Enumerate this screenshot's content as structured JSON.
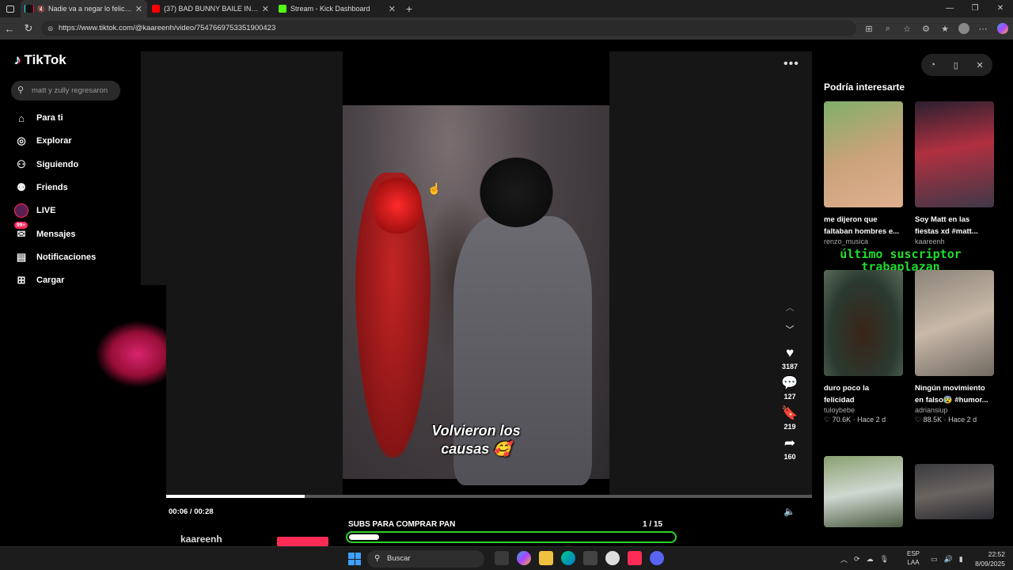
{
  "browser": {
    "tabs": [
      {
        "title": "Nadie va a negar lo felices q",
        "favicon": "tiktok-icon",
        "muted": true,
        "active": true
      },
      {
        "title": "(37) BAD BUNNY BAILE INoLVIDA",
        "favicon": "youtube-icon",
        "active": false
      },
      {
        "title": "Stream - Kick Dashboard",
        "favicon": "kick-icon",
        "active": false
      }
    ],
    "url": "https://www.tiktok.com/@kaareenh/video/7547669753351900423"
  },
  "sidebar": {
    "logo": "TikTok",
    "search_placeholder": "matt y zully regresaron",
    "items": [
      {
        "label": "Para ti",
        "icon": "home-icon"
      },
      {
        "label": "Explorar",
        "icon": "compass-icon"
      },
      {
        "label": "Siguiendo",
        "icon": "following-icon"
      },
      {
        "label": "Friends",
        "icon": "friends-icon"
      },
      {
        "label": "LIVE",
        "icon": "live-avatar"
      },
      {
        "label": "Mensajes",
        "icon": "messages-icon",
        "badge": "99+"
      },
      {
        "label": "Notificaciones",
        "icon": "inbox-icon"
      },
      {
        "label": "Cargar",
        "icon": "upload-icon"
      }
    ]
  },
  "video": {
    "caption_line1": "Volvieron los",
    "caption_line2": "causas 🥰",
    "likes": "3187",
    "comments": "127",
    "saves": "219",
    "shares": "160",
    "time": "00:06 / 00:28",
    "progress": 0.214,
    "author": "kaareenh"
  },
  "stream_overlay": {
    "goal_title": "SUBS PARA COMPRAR PAN",
    "goal_current": "1",
    "goal_total": "/ 15",
    "goal_progress": 0.067,
    "scroller_line1": "último suscriptor",
    "scroller_line2": "trabaplazan"
  },
  "recommended": {
    "title": "Podría interesarte",
    "cards": [
      {
        "title_line1": "me dijeron que",
        "title_line2": "faltaban hombres e...",
        "author": "renzo_musica",
        "stats": ""
      },
      {
        "title_line1": "Soy Matt en las",
        "title_line2": "fiestas xd #matt...",
        "author": "kaareenh",
        "stats": ""
      },
      {
        "title_line1": "duro poco la",
        "title_line2": "felicidad",
        "author": "tuloybebe",
        "stats": "♡ 70.6K · Hace 2 d"
      },
      {
        "title_line1": "Ningún movimiento",
        "title_line2": "en falso😰 #humor...",
        "author": "adriansiup",
        "stats": "♡ 88.5K · Hace 2 d"
      },
      {
        "title_line1": "",
        "title_line2": "",
        "author": "",
        "stats": ""
      },
      {
        "title_line1": "",
        "title_line2": "",
        "author": "",
        "stats": ""
      }
    ]
  },
  "taskbar": {
    "search_label": "Buscar",
    "lang_line1": "ESP",
    "lang_line2": "LAA",
    "time": "22:52",
    "date": "8/09/2025"
  },
  "colors": {
    "tiktok_red": "#fe2c55",
    "goal_green": "#2fd12f",
    "scroller_green": "#1fdd2f"
  }
}
